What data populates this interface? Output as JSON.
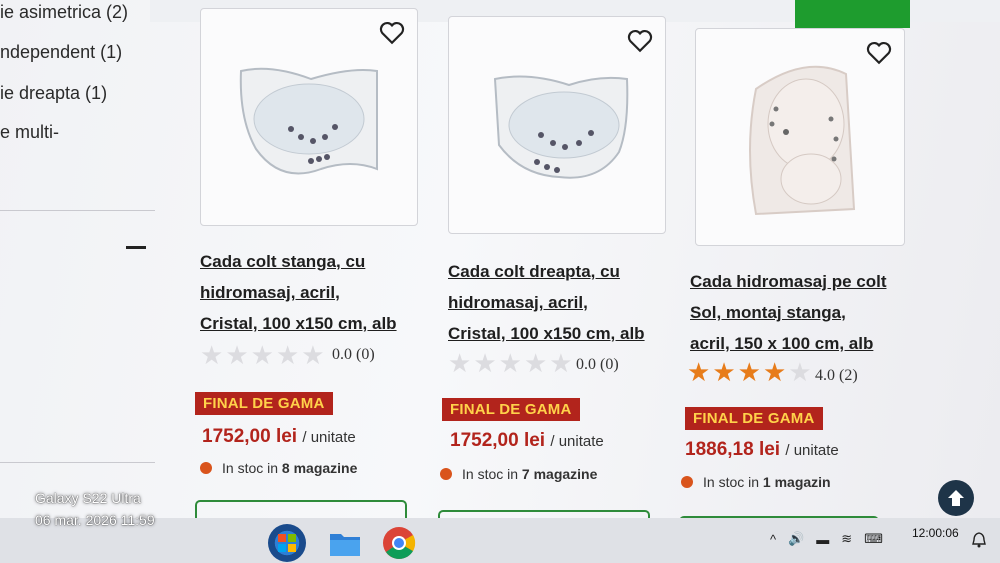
{
  "filters": {
    "items": [
      {
        "label": "ie asimetrica (2)"
      },
      {
        "label": "ndependent (1)"
      },
      {
        "label": "ie dreapta (1)"
      },
      {
        "label": "e multi-"
      }
    ],
    "collapse_symbol": "−"
  },
  "products": [
    {
      "title": "Cada colt stanga, cu hidromasaj, acril, Cristal, 100 x150 cm, alb",
      "title_lines": [
        "Cada colt stanga, cu",
        "hidromasaj, acril,",
        "Cristal, 100 x150 cm, alb"
      ],
      "rating_value": 0,
      "rating_text": "0.0 (0)",
      "badge": "FINAL DE GAMA",
      "price": "1752,00 lei",
      "unit": "/ unitate",
      "stock_prefix": "In stoc in",
      "stock_bold": "8 magazine"
    },
    {
      "title": "Cada colt dreapta, cu hidromasaj, acril, Cristal, 100 x150 cm, alb",
      "title_lines": [
        "Cada colt dreapta, cu",
        "hidromasaj, acril,",
        "Cristal, 100 x150 cm, alb"
      ],
      "rating_value": 0,
      "rating_text": "0.0 (0)",
      "badge": "FINAL DE GAMA",
      "price": "1752,00 lei",
      "unit": "/ unitate",
      "stock_prefix": "In stoc in",
      "stock_bold": "7 magazine"
    },
    {
      "title": "Cada hidromasaj pe colt Sol, montaj stanga, acril, 150 x 100 cm, alb",
      "title_lines": [
        "Cada hidromasaj pe colt",
        "Sol, montaj stanga,",
        "acril, 150 x 100 cm, alb"
      ],
      "rating_value": 4,
      "rating_text": "4.0 (2)",
      "badge": "FINAL DE GAMA",
      "price": "1886,18 lei",
      "unit": "/ unitate",
      "stock_prefix": "In stoc in",
      "stock_bold": "1 magazin"
    }
  ],
  "icons": {
    "favorite": "heart-icon",
    "scroll_top": "arrow-up-icon",
    "taskbar": [
      "windows-start-icon",
      "file-explorer-icon",
      "chrome-icon"
    ]
  },
  "colors": {
    "badge_bg": "#b2241c",
    "badge_text": "#ffd24a",
    "price": "#b2241c",
    "star_filled": "#e77c1a",
    "stock_dot": "#d9541c",
    "accent_green": "#1e9c2e"
  },
  "phone_overlay": {
    "device": "Galaxy S22 Ultra",
    "datetime": "06 mar. 2026 11:59"
  },
  "taskbar": {
    "clock": "12:00:06",
    "tray_chevron": "^"
  }
}
